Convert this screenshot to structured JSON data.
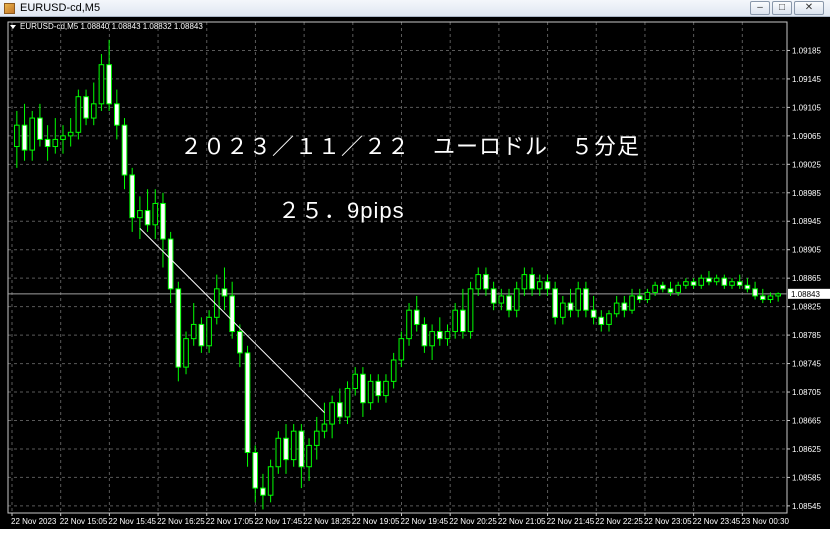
{
  "window": {
    "title": "EURUSD-cd,M5",
    "minimize_glyph": "–",
    "maximize_glyph": "□",
    "close_glyph": "✕"
  },
  "chart_data": {
    "type": "candlestick",
    "symbol_info": "EURUSD-cd,M5  1.08840 1.08843 1.08832 1.08843",
    "current_price_label": "1.08843",
    "current_price": 1.08843,
    "ylim": [
      1.08535,
      1.09225
    ],
    "y_ticks": [
      "1.09185",
      "1.09145",
      "1.09105",
      "1.09065",
      "1.09025",
      "1.08985",
      "1.08945",
      "1.08905",
      "1.08865",
      "1.08825",
      "1.08785",
      "1.08745",
      "1.08705",
      "1.08665",
      "1.08625",
      "1.08585",
      "1.08545"
    ],
    "x_ticks": [
      "22 Nov 2023",
      "22 Nov 15:05",
      "22 Nov 15:45",
      "22 Nov 16:25",
      "22 Nov 17:05",
      "22 Nov 17:45",
      "22 Nov 18:25",
      "22 Nov 19:05",
      "22 Nov 19:45",
      "22 Nov 20:25",
      "22 Nov 21:05",
      "22 Nov 21:45",
      "22 Nov 22:25",
      "22 Nov 23:05",
      "22 Nov 23:45",
      "23 Nov 00:30"
    ],
    "annotation_title": "２０２３／１１／２２　ユーロドル　５分足",
    "annotation_pips": "２５．9pips",
    "trendline": {
      "from_index": 16,
      "to_index": 40,
      "from_price": 1.08935,
      "to_price": 1.08676
    },
    "candles": [
      {
        "o": 1.0905,
        "h": 1.091,
        "l": 1.0902,
        "c": 1.0908
      },
      {
        "o": 1.0908,
        "h": 1.0911,
        "l": 1.0903,
        "c": 1.09045
      },
      {
        "o": 1.09045,
        "h": 1.091,
        "l": 1.0903,
        "c": 1.0909
      },
      {
        "o": 1.0909,
        "h": 1.0911,
        "l": 1.0905,
        "c": 1.0906
      },
      {
        "o": 1.0906,
        "h": 1.0908,
        "l": 1.0903,
        "c": 1.0905
      },
      {
        "o": 1.0905,
        "h": 1.0909,
        "l": 1.0904,
        "c": 1.0906
      },
      {
        "o": 1.0906,
        "h": 1.0908,
        "l": 1.0904,
        "c": 1.09065
      },
      {
        "o": 1.09065,
        "h": 1.0909,
        "l": 1.0905,
        "c": 1.0907
      },
      {
        "o": 1.0907,
        "h": 1.0913,
        "l": 1.0906,
        "c": 1.0912
      },
      {
        "o": 1.0912,
        "h": 1.0913,
        "l": 1.0908,
        "c": 1.0909
      },
      {
        "o": 1.0909,
        "h": 1.0914,
        "l": 1.0908,
        "c": 1.0911
      },
      {
        "o": 1.0911,
        "h": 1.0918,
        "l": 1.091,
        "c": 1.09165
      },
      {
        "o": 1.09165,
        "h": 1.092,
        "l": 1.091,
        "c": 1.0911
      },
      {
        "o": 1.0911,
        "h": 1.0913,
        "l": 1.0906,
        "c": 1.0908
      },
      {
        "o": 1.0908,
        "h": 1.0909,
        "l": 1.0899,
        "c": 1.0901
      },
      {
        "o": 1.0901,
        "h": 1.0902,
        "l": 1.0893,
        "c": 1.0895
      },
      {
        "o": 1.0895,
        "h": 1.0898,
        "l": 1.0892,
        "c": 1.0896
      },
      {
        "o": 1.0896,
        "h": 1.0899,
        "l": 1.0893,
        "c": 1.0894
      },
      {
        "o": 1.0894,
        "h": 1.0899,
        "l": 1.0892,
        "c": 1.0897
      },
      {
        "o": 1.0897,
        "h": 1.08985,
        "l": 1.0888,
        "c": 1.0892
      },
      {
        "o": 1.0892,
        "h": 1.0893,
        "l": 1.0883,
        "c": 1.0885
      },
      {
        "o": 1.0885,
        "h": 1.0886,
        "l": 1.0872,
        "c": 1.0874
      },
      {
        "o": 1.0874,
        "h": 1.0879,
        "l": 1.0873,
        "c": 1.0878
      },
      {
        "o": 1.0878,
        "h": 1.0883,
        "l": 1.0877,
        "c": 1.088
      },
      {
        "o": 1.088,
        "h": 1.0881,
        "l": 1.0876,
        "c": 1.0877
      },
      {
        "o": 1.0877,
        "h": 1.0882,
        "l": 1.0876,
        "c": 1.0881
      },
      {
        "o": 1.0881,
        "h": 1.0887,
        "l": 1.088,
        "c": 1.0885
      },
      {
        "o": 1.0885,
        "h": 1.0888,
        "l": 1.0882,
        "c": 1.0884
      },
      {
        "o": 1.0884,
        "h": 1.0886,
        "l": 1.0878,
        "c": 1.0879
      },
      {
        "o": 1.0879,
        "h": 1.088,
        "l": 1.0874,
        "c": 1.0876
      },
      {
        "o": 1.0876,
        "h": 1.0877,
        "l": 1.086,
        "c": 1.0862
      },
      {
        "o": 1.0862,
        "h": 1.0863,
        "l": 1.0855,
        "c": 1.0857
      },
      {
        "o": 1.0857,
        "h": 1.0859,
        "l": 1.0854,
        "c": 1.0856
      },
      {
        "o": 1.0856,
        "h": 1.0861,
        "l": 1.0855,
        "c": 1.086
      },
      {
        "o": 1.086,
        "h": 1.0865,
        "l": 1.0859,
        "c": 1.0864
      },
      {
        "o": 1.0864,
        "h": 1.0866,
        "l": 1.0859,
        "c": 1.0861
      },
      {
        "o": 1.0861,
        "h": 1.0866,
        "l": 1.086,
        "c": 1.0865
      },
      {
        "o": 1.0865,
        "h": 1.0866,
        "l": 1.0857,
        "c": 1.086
      },
      {
        "o": 1.086,
        "h": 1.0864,
        "l": 1.0858,
        "c": 1.0863
      },
      {
        "o": 1.0863,
        "h": 1.0867,
        "l": 1.0861,
        "c": 1.0865
      },
      {
        "o": 1.0865,
        "h": 1.0869,
        "l": 1.0864,
        "c": 1.0866
      },
      {
        "o": 1.0866,
        "h": 1.087,
        "l": 1.0864,
        "c": 1.0869
      },
      {
        "o": 1.0869,
        "h": 1.0871,
        "l": 1.0866,
        "c": 1.0867
      },
      {
        "o": 1.0867,
        "h": 1.0872,
        "l": 1.0866,
        "c": 1.0871
      },
      {
        "o": 1.0871,
        "h": 1.0874,
        "l": 1.087,
        "c": 1.0873
      },
      {
        "o": 1.0873,
        "h": 1.0874,
        "l": 1.0867,
        "c": 1.0869
      },
      {
        "o": 1.0869,
        "h": 1.0873,
        "l": 1.0868,
        "c": 1.0872
      },
      {
        "o": 1.0872,
        "h": 1.0873,
        "l": 1.0869,
        "c": 1.087
      },
      {
        "o": 1.087,
        "h": 1.0873,
        "l": 1.0869,
        "c": 1.0872
      },
      {
        "o": 1.0872,
        "h": 1.0876,
        "l": 1.0871,
        "c": 1.0875
      },
      {
        "o": 1.0875,
        "h": 1.0879,
        "l": 1.0874,
        "c": 1.0878
      },
      {
        "o": 1.0878,
        "h": 1.0883,
        "l": 1.0877,
        "c": 1.0882
      },
      {
        "o": 1.0882,
        "h": 1.0884,
        "l": 1.0879,
        "c": 1.088
      },
      {
        "o": 1.088,
        "h": 1.0881,
        "l": 1.0876,
        "c": 1.0877
      },
      {
        "o": 1.0877,
        "h": 1.088,
        "l": 1.0875,
        "c": 1.0879
      },
      {
        "o": 1.0879,
        "h": 1.0881,
        "l": 1.0877,
        "c": 1.0878
      },
      {
        "o": 1.0878,
        "h": 1.088,
        "l": 1.0877,
        "c": 1.0879
      },
      {
        "o": 1.0879,
        "h": 1.0883,
        "l": 1.0878,
        "c": 1.0882
      },
      {
        "o": 1.0882,
        "h": 1.0885,
        "l": 1.0878,
        "c": 1.0879
      },
      {
        "o": 1.0879,
        "h": 1.0886,
        "l": 1.0878,
        "c": 1.0885
      },
      {
        "o": 1.0885,
        "h": 1.0888,
        "l": 1.0884,
        "c": 1.0887
      },
      {
        "o": 1.0887,
        "h": 1.0888,
        "l": 1.0884,
        "c": 1.0885
      },
      {
        "o": 1.0885,
        "h": 1.0886,
        "l": 1.0882,
        "c": 1.0883
      },
      {
        "o": 1.0883,
        "h": 1.0885,
        "l": 1.0882,
        "c": 1.0884
      },
      {
        "o": 1.0884,
        "h": 1.0885,
        "l": 1.0881,
        "c": 1.0882
      },
      {
        "o": 1.0882,
        "h": 1.0886,
        "l": 1.0881,
        "c": 1.0885
      },
      {
        "o": 1.0885,
        "h": 1.0888,
        "l": 1.0884,
        "c": 1.0887
      },
      {
        "o": 1.0887,
        "h": 1.0888,
        "l": 1.0884,
        "c": 1.0885
      },
      {
        "o": 1.0885,
        "h": 1.0887,
        "l": 1.0884,
        "c": 1.0886
      },
      {
        "o": 1.0886,
        "h": 1.0887,
        "l": 1.0884,
        "c": 1.0885
      },
      {
        "o": 1.0885,
        "h": 1.0886,
        "l": 1.088,
        "c": 1.0881
      },
      {
        "o": 1.0881,
        "h": 1.0884,
        "l": 1.088,
        "c": 1.0883
      },
      {
        "o": 1.0883,
        "h": 1.0885,
        "l": 1.0881,
        "c": 1.0882
      },
      {
        "o": 1.0882,
        "h": 1.0886,
        "l": 1.0881,
        "c": 1.0885
      },
      {
        "o": 1.0885,
        "h": 1.0886,
        "l": 1.0881,
        "c": 1.0882
      },
      {
        "o": 1.0882,
        "h": 1.0884,
        "l": 1.088,
        "c": 1.0881
      },
      {
        "o": 1.0881,
        "h": 1.0882,
        "l": 1.0879,
        "c": 1.088
      },
      {
        "o": 1.088,
        "h": 1.0882,
        "l": 1.0879,
        "c": 1.08815
      },
      {
        "o": 1.08815,
        "h": 1.0884,
        "l": 1.0881,
        "c": 1.0883
      },
      {
        "o": 1.0883,
        "h": 1.0884,
        "l": 1.0881,
        "c": 1.0882
      },
      {
        "o": 1.0882,
        "h": 1.0885,
        "l": 1.08815,
        "c": 1.0884
      },
      {
        "o": 1.0884,
        "h": 1.0885,
        "l": 1.0883,
        "c": 1.08835
      },
      {
        "o": 1.08835,
        "h": 1.0885,
        "l": 1.0883,
        "c": 1.08845
      },
      {
        "o": 1.08845,
        "h": 1.0886,
        "l": 1.0884,
        "c": 1.08855
      },
      {
        "o": 1.08855,
        "h": 1.0886,
        "l": 1.08845,
        "c": 1.0885
      },
      {
        "o": 1.0885,
        "h": 1.0886,
        "l": 1.0884,
        "c": 1.08845
      },
      {
        "o": 1.08845,
        "h": 1.0886,
        "l": 1.0884,
        "c": 1.08855
      },
      {
        "o": 1.08855,
        "h": 1.08865,
        "l": 1.0885,
        "c": 1.0886
      },
      {
        "o": 1.0886,
        "h": 1.08865,
        "l": 1.0885,
        "c": 1.08855
      },
      {
        "o": 1.08855,
        "h": 1.0887,
        "l": 1.0885,
        "c": 1.08865
      },
      {
        "o": 1.08865,
        "h": 1.08875,
        "l": 1.08855,
        "c": 1.0886
      },
      {
        "o": 1.0886,
        "h": 1.0887,
        "l": 1.08855,
        "c": 1.08865
      },
      {
        "o": 1.08865,
        "h": 1.0887,
        "l": 1.0885,
        "c": 1.08855
      },
      {
        "o": 1.08855,
        "h": 1.08865,
        "l": 1.0885,
        "c": 1.0886
      },
      {
        "o": 1.0886,
        "h": 1.0887,
        "l": 1.0885,
        "c": 1.08855
      },
      {
        "o": 1.08855,
        "h": 1.08865,
        "l": 1.08845,
        "c": 1.0885
      },
      {
        "o": 1.0885,
        "h": 1.0886,
        "l": 1.08835,
        "c": 1.0884
      },
      {
        "o": 1.0884,
        "h": 1.0885,
        "l": 1.0883,
        "c": 1.08835
      },
      {
        "o": 1.08835,
        "h": 1.08845,
        "l": 1.0883,
        "c": 1.0884
      },
      {
        "o": 1.0884,
        "h": 1.08845,
        "l": 1.08832,
        "c": 1.08843
      }
    ]
  }
}
